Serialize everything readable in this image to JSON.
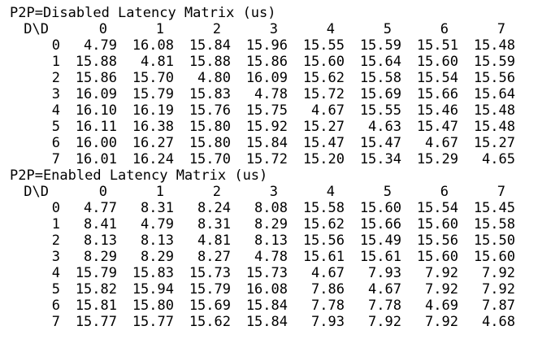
{
  "colors": {
    "background": "#ffffff",
    "text": "#000000"
  },
  "disabled": {
    "title": "P2P=Disabled Latency Matrix (us)",
    "corner": "D\\D",
    "headers": [
      "0",
      "1",
      "2",
      "3",
      "4",
      "5",
      "6",
      "7"
    ],
    "rows": [
      {
        "label": "0",
        "values": [
          "4.79",
          "16.08",
          "15.84",
          "15.96",
          "15.55",
          "15.59",
          "15.51",
          "15.48"
        ]
      },
      {
        "label": "1",
        "values": [
          "15.88",
          "4.81",
          "15.88",
          "15.86",
          "15.60",
          "15.64",
          "15.60",
          "15.59"
        ]
      },
      {
        "label": "2",
        "values": [
          "15.86",
          "15.70",
          "4.80",
          "16.09",
          "15.62",
          "15.58",
          "15.54",
          "15.56"
        ]
      },
      {
        "label": "3",
        "values": [
          "16.09",
          "15.79",
          "15.83",
          "4.78",
          "15.72",
          "15.69",
          "15.66",
          "15.64"
        ]
      },
      {
        "label": "4",
        "values": [
          "16.10",
          "16.19",
          "15.76",
          "15.75",
          "4.67",
          "15.55",
          "15.46",
          "15.48"
        ]
      },
      {
        "label": "5",
        "values": [
          "16.11",
          "16.38",
          "15.80",
          "15.92",
          "15.27",
          "4.63",
          "15.47",
          "15.48"
        ]
      },
      {
        "label": "6",
        "values": [
          "16.00",
          "16.27",
          "15.80",
          "15.84",
          "15.47",
          "15.47",
          "4.67",
          "15.27"
        ]
      },
      {
        "label": "7",
        "values": [
          "16.01",
          "16.24",
          "15.70",
          "15.72",
          "15.20",
          "15.34",
          "15.29",
          "4.65"
        ]
      }
    ]
  },
  "enabled": {
    "title": "P2P=Enabled Latency Matrix (us)",
    "corner": "D\\D",
    "headers": [
      "0",
      "1",
      "2",
      "3",
      "4",
      "5",
      "6",
      "7"
    ],
    "rows": [
      {
        "label": "0",
        "values": [
          "4.77",
          "8.31",
          "8.24",
          "8.08",
          "15.58",
          "15.60",
          "15.54",
          "15.45"
        ]
      },
      {
        "label": "1",
        "values": [
          "8.41",
          "4.79",
          "8.31",
          "8.29",
          "15.62",
          "15.66",
          "15.60",
          "15.58"
        ]
      },
      {
        "label": "2",
        "values": [
          "8.13",
          "8.13",
          "4.81",
          "8.13",
          "15.56",
          "15.49",
          "15.56",
          "15.50"
        ]
      },
      {
        "label": "3",
        "values": [
          "8.29",
          "8.29",
          "8.27",
          "4.78",
          "15.61",
          "15.61",
          "15.60",
          "15.60"
        ]
      },
      {
        "label": "4",
        "values": [
          "15.79",
          "15.83",
          "15.73",
          "15.73",
          "4.67",
          "7.93",
          "7.92",
          "7.92"
        ]
      },
      {
        "label": "5",
        "values": [
          "15.82",
          "15.94",
          "15.79",
          "16.08",
          "7.86",
          "4.67",
          "7.92",
          "7.92"
        ]
      },
      {
        "label": "6",
        "values": [
          "15.81",
          "15.80",
          "15.69",
          "15.84",
          "7.78",
          "7.78",
          "4.69",
          "7.87"
        ]
      },
      {
        "label": "7",
        "values": [
          "15.77",
          "15.77",
          "15.62",
          "15.84",
          "7.93",
          "7.92",
          "7.92",
          "4.68"
        ]
      }
    ]
  }
}
